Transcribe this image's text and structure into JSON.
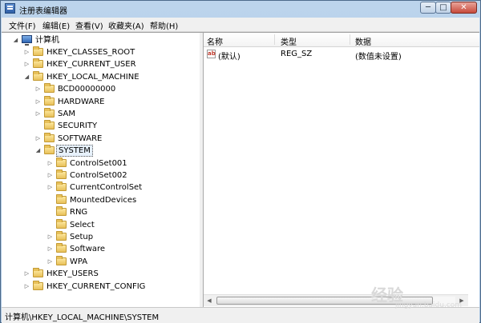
{
  "window": {
    "title": "注册表编辑器",
    "controls": {
      "minimize": "─",
      "maximize": "□",
      "close": "✕"
    }
  },
  "menu": [
    "文件(F)",
    "编辑(E)",
    "查看(V)",
    "收藏夹(A)",
    "帮助(H)"
  ],
  "tree": {
    "root": "计算机",
    "nodes": [
      {
        "label": "HKEY_CLASSES_ROOT",
        "arrow": "▷"
      },
      {
        "label": "HKEY_CURRENT_USER",
        "arrow": "▷"
      },
      {
        "label": "HKEY_LOCAL_MACHINE",
        "arrow": "◢"
      },
      {
        "label": "BCD00000000",
        "arrow": "▷"
      },
      {
        "label": "HARDWARE",
        "arrow": "▷"
      },
      {
        "label": "SAM",
        "arrow": "▷"
      },
      {
        "label": "SECURITY",
        "arrow": ""
      },
      {
        "label": "SOFTWARE",
        "arrow": "▷"
      },
      {
        "label": "SYSTEM",
        "arrow": "◢",
        "selected": true
      },
      {
        "label": "ControlSet001",
        "arrow": "▷"
      },
      {
        "label": "ControlSet002",
        "arrow": "▷"
      },
      {
        "label": "CurrentControlSet",
        "arrow": "▷"
      },
      {
        "label": "MountedDevices",
        "arrow": ""
      },
      {
        "label": "RNG",
        "arrow": ""
      },
      {
        "label": "Select",
        "arrow": ""
      },
      {
        "label": "Setup",
        "arrow": "▷"
      },
      {
        "label": "Software",
        "arrow": "▷"
      },
      {
        "label": "WPA",
        "arrow": "▷"
      },
      {
        "label": "HKEY_USERS",
        "arrow": "▷"
      },
      {
        "label": "HKEY_CURRENT_CONFIG",
        "arrow": "▷"
      }
    ]
  },
  "list": {
    "columns": [
      "名称",
      "类型",
      "数据"
    ],
    "rows": [
      {
        "name": "(默认)",
        "type": "REG_SZ",
        "data": "(数值未设置)",
        "icon": "ab"
      }
    ]
  },
  "statusbar": {
    "path": "计算机\\HKEY_LOCAL_MACHINE\\SYSTEM"
  },
  "scrollbar": {
    "left": "◀",
    "right": "▶"
  },
  "watermark": {
    "text": "经验",
    "sub": "jingyan.baidu.com"
  }
}
